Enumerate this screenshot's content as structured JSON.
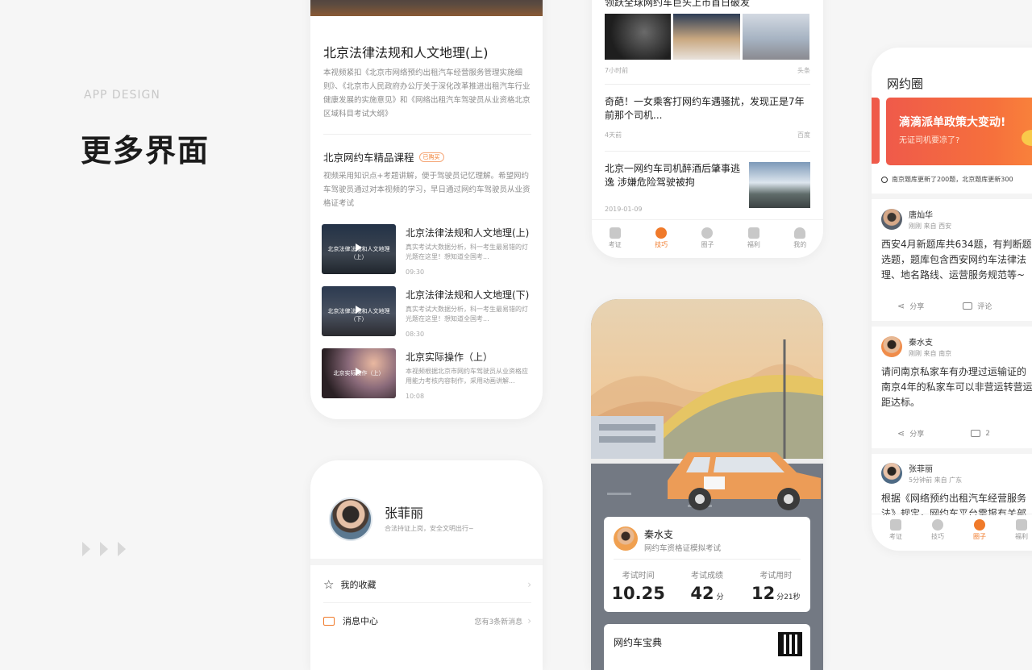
{
  "intro": {
    "eyebrow": "APP DESIGN",
    "title": "更多界面"
  },
  "card1": {
    "title": "北京法律法规和人文地理(上)",
    "desc": "本视频紧扣《北京市网络预约出租汽车经营服务管理实施细则》、《北京市人民政府办公厅关于深化改革推进出租汽车行业健康发展的实施意见》和《网络出租汽车驾驶员从业资格北京区域科目考试大纲》",
    "section_title": "北京网约车精品课程",
    "badge": "已购买",
    "section_desc": "视频采用知识点+考题讲解，便于驾驶员记忆理解。希望网约车驾驶员通过对本视频的学习，早日通过网约车驾驶员从业资格证考试",
    "courses": [
      {
        "thumb_text": "北京法律法规和人文地理（上）",
        "title": "北京法律法规和人文地理(上)",
        "desc": "真实考试大数据分析，科一考生最易错的灯光题在这里！想知道全国考...",
        "time": "09:30"
      },
      {
        "thumb_text": "北京法律法规和人文地理（下）",
        "title": "北京法律法规和人文地理(下)",
        "desc": "真实考试大数据分析，科一考生最易错的灯光题在这里！想知道全国考...",
        "time": "08:30"
      },
      {
        "thumb_text": "北京实际操作（上）",
        "title": "北京实际操作（上）",
        "desc": "本视频根据北京市网约车驾驶员从业资格应用能力考核内容制作，采用动画讲解...",
        "time": "10:08"
      }
    ]
  },
  "profile": {
    "name": "张菲丽",
    "motto": "合法持证上岗，安全文明出行~",
    "menu": [
      {
        "label": "我的收藏",
        "note": ""
      },
      {
        "label": "消息中心",
        "note": "您有3条新消息"
      }
    ]
  },
  "news": {
    "top_title": "领跃全球网约车巨头上市首日破发",
    "items": [
      {
        "time": "7小时前",
        "source": "头条"
      },
      {
        "title": "奇葩！一女乘客打网约车遇骚扰，发现正是7年前那个司机...",
        "time": "4天前",
        "source": "百度"
      },
      {
        "title": "北京一网约车司机醉酒后肇事逃逸 涉嫌危险驾驶被拘",
        "time": "2019-01-09"
      }
    ],
    "tabs": [
      "考证",
      "技巧",
      "圈子",
      "福利",
      "我的"
    ],
    "active_tab": 1
  },
  "exam": {
    "name": "秦水支",
    "subtitle": "网约车资格证模拟考试",
    "stats": [
      {
        "label": "考试时间",
        "value": "10.25",
        "unit": ""
      },
      {
        "label": "考试成绩",
        "value": "42",
        "unit": "分"
      },
      {
        "label": "考试用时",
        "value": "12",
        "unit": "分21秒"
      }
    ],
    "bottom_title": "网约车宝典"
  },
  "circle": {
    "title": "网约圈",
    "banner_title": "滴滴派单政策大变动!",
    "banner_sub": "无证司机要凉了?",
    "ticker": "南京题库更新了200题，北京题库更新300",
    "posts": [
      {
        "name": "唐灿华",
        "meta": "刚刚 来自 西安",
        "text": [
          "西安4月新题库共634题，有判断题",
          "选题，题库包含西安网约车法律法",
          "理、地名路线、运营服务规范等~"
        ],
        "share": "分享",
        "comment": "评论"
      },
      {
        "name": "秦水支",
        "meta": "刚刚 来自 南京",
        "text": [
          "请问南京私家车有办理过运输证的",
          "南京4年的私家车可以非营运转营运",
          "距达标。"
        ],
        "share": "分享",
        "comment": "2"
      },
      {
        "name": "张菲丽",
        "meta": "5分钟前 来自 广东",
        "text": [
          "根据《网络预约出租汽车经营服务",
          "法》规定，网约车平台需报有关部"
        ]
      }
    ],
    "tabs": [
      "考证",
      "技巧",
      "圈子",
      "福利"
    ],
    "active_tab": 2
  }
}
